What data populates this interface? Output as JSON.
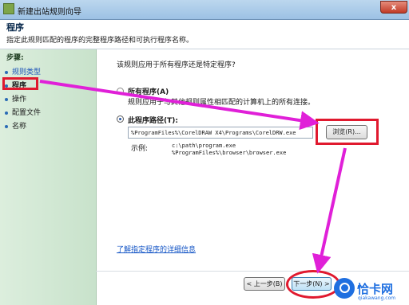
{
  "window": {
    "title": "新建出站规则向导",
    "close_label": "x"
  },
  "header": {
    "title": "程序",
    "description": "指定此规则匹配的程序的完整程序路径和可执行程序名称。"
  },
  "steps": {
    "title": "步骤:",
    "items": [
      {
        "label": "规则类型"
      },
      {
        "label": "程序"
      },
      {
        "label": "操作"
      },
      {
        "label": "配置文件"
      },
      {
        "label": "名称"
      }
    ]
  },
  "main": {
    "question": "该规则应用于所有程序还是特定程序?",
    "all_programs": {
      "label": "所有程序(A)",
      "description": "规则应用于与其他规则属性相匹配的计算机上的所有连接。"
    },
    "this_program": {
      "label": "此程序路径(T):",
      "path_value": "%ProgramFiles%\\CorelDRAW X4\\Programs\\CorelDRW.exe",
      "browse_label": "浏览(R)..."
    },
    "example": {
      "label": "示例:",
      "line1": "c:\\path\\program.exe",
      "line2": "%ProgramFiles%\\browser\\browser.exe"
    },
    "learn_more_link": "了解指定程序的详细信息"
  },
  "footer": {
    "back_label": "< 上一步(B)",
    "next_label": "下一步(N) >"
  },
  "watermark": {
    "brand": "恰卡网",
    "subtitle": "qiakawang.com"
  },
  "colors": {
    "annotation": "#e0192e",
    "arrow": "#e020d8",
    "link": "#1556c6",
    "step_panel": "#d2e8d4"
  }
}
